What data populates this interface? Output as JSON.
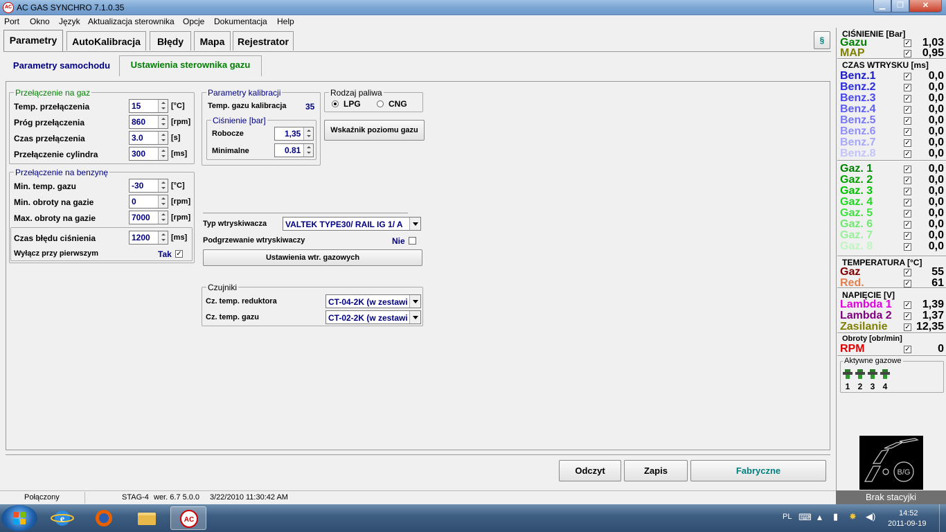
{
  "window": {
    "title": "AC GAS SYNCHRO  7.1.0.35",
    "icon_text": "AC",
    "min": "▁",
    "max": "❐",
    "close": "✕"
  },
  "menu": [
    "Port",
    "Okno",
    "Język",
    "Aktualizacja sterownika",
    "Opcje",
    "Dokumentacja",
    "Help"
  ],
  "tabs": [
    "Parametry",
    "AutoKalibracja",
    "Błędy",
    "Mapa",
    "Rejestrator"
  ],
  "subtabs": [
    "Parametry samochodu",
    "Ustawienia sterownika gazu"
  ],
  "gas_switch": {
    "title": "Przełączenie na gaz",
    "rows": [
      {
        "label": "Temp. przełączenia",
        "value": "15",
        "unit": "[°C]"
      },
      {
        "label": "Próg przełączenia",
        "value": "860",
        "unit": "[rpm]"
      },
      {
        "label": "Czas przełączenia",
        "value": "3.0",
        "unit": "[s]"
      },
      {
        "label": "Przełączenie cylindra",
        "value": "300",
        "unit": "[ms]"
      }
    ]
  },
  "petrol_switch": {
    "title": "Przełączenie na benzynę",
    "rows": [
      {
        "label": "Min. temp. gazu",
        "value": "-30",
        "unit": "[°C]"
      },
      {
        "label": "Min. obroty na gazie",
        "value": "0",
        "unit": "[rpm]"
      },
      {
        "label": "Max. obroty na gazie",
        "value": "7000",
        "unit": "[rpm]"
      }
    ]
  },
  "pressure_error": {
    "label": "Czas błędu ciśnienia",
    "value": "1200",
    "unit": "[ms]",
    "first_label": "Wyłącz przy pierwszym",
    "first_value": "Tak",
    "check": "✓"
  },
  "calibration": {
    "title": "Parametry kalibracji",
    "temp_label": "Temp. gazu kalibracja",
    "temp_value": "35",
    "pressure_title": "Ciśnienie [bar]",
    "working_label": "Robocze",
    "working_value": "1,35",
    "min_label": "Minimalne",
    "min_value": "0.81"
  },
  "fuel": {
    "title": "Rodzaj paliwa",
    "lpg": "LPG",
    "cng": "CNG",
    "selected": "LPG"
  },
  "gas_level_button": "Wskaźnik poziomu gazu",
  "injector": {
    "type_label": "Typ wtryskiwacza",
    "type_value": "VALTEK TYPE30/ RAIL IG 1/ A",
    "heat_label": "Podgrzewanie wtryskiwaczy",
    "heat_value": "Nie",
    "settings_button": "Ustawienia wtr. gazowych"
  },
  "sensors": {
    "title": "Czujniki",
    "reducer_label": "Cz. temp. reduktora",
    "reducer_value": "CT-04-2K (w zestawi",
    "gas_label": "Cz. temp. gazu",
    "gas_value": "CT-02-2K (w zestawi"
  },
  "buttons": {
    "read": "Odczyt",
    "write": "Zapis",
    "factory": "Fabryczne"
  },
  "right_panel": {
    "pressure_title": "CIŚNIENIE [Bar]",
    "pressure": [
      {
        "name": "Gazu",
        "value": "1,03",
        "color": "#008000"
      },
      {
        "name": "MAP",
        "value": "0,95",
        "color": "#808000"
      }
    ],
    "inj_title": "CZAS WTRYSKU  [ms]",
    "petrol": [
      {
        "name": "Benz.1",
        "value": "0,0",
        "color": "#1a1acc"
      },
      {
        "name": "Benz.2",
        "value": "0,0",
        "color": "#2d2de0"
      },
      {
        "name": "Benz.3",
        "value": "0,0",
        "color": "#4848ee"
      },
      {
        "name": "Benz.4",
        "value": "0,0",
        "color": "#5f5ff2"
      },
      {
        "name": "Benz.5",
        "value": "0,0",
        "color": "#7878f5"
      },
      {
        "name": "Benz.6",
        "value": "0,0",
        "color": "#9090f7"
      },
      {
        "name": "Benz.7",
        "value": "0,0",
        "color": "#a8a8f8"
      },
      {
        "name": "Benz.8",
        "value": "0,0",
        "color": "#c4c4fa"
      }
    ],
    "gas": [
      {
        "name": "Gaz. 1",
        "value": "0,0",
        "color": "#008000"
      },
      {
        "name": "Gaz. 2",
        "value": "0,0",
        "color": "#00a000"
      },
      {
        "name": "Gaz. 3",
        "value": "0,0",
        "color": "#00c000"
      },
      {
        "name": "Gaz. 4",
        "value": "0,0",
        "color": "#20d820"
      },
      {
        "name": "Gaz. 5",
        "value": "0,0",
        "color": "#40e040"
      },
      {
        "name": "Gaz. 6",
        "value": "0,0",
        "color": "#70e870"
      },
      {
        "name": "Gaz. 7",
        "value": "0,0",
        "color": "#98f098"
      },
      {
        "name": "Gaz. 8",
        "value": "0,0",
        "color": "#c0f4c0"
      }
    ],
    "temp_title": "TEMPERATURA  [°C]",
    "temp": [
      {
        "name": "Gaz",
        "value": "55",
        "color": "#800000"
      },
      {
        "name": "Red.",
        "value": "61",
        "color": "#e08050"
      }
    ],
    "volt_title": "NAPIĘCIE [V]",
    "volt": [
      {
        "name": "Lambda 1",
        "value": "1,39",
        "color": "#e000e0"
      },
      {
        "name": "Lambda 2",
        "value": "1,37",
        "color": "#800080"
      },
      {
        "name": "Zasilanie",
        "value": "12,35",
        "color": "#808000"
      }
    ],
    "rpm_title": "Obroty [obr/min]",
    "rpm": [
      {
        "name": "RPM",
        "value": "0",
        "color": "#e00000"
      }
    ],
    "active_title": "Aktywne gazowe",
    "active": [
      "1",
      "2",
      "3",
      "4"
    ],
    "check": "✓",
    "logo_text": "B/G"
  },
  "status": {
    "state": "Połączony",
    "device": "STAG-4",
    "version": "wer. 6.7  5.0.0",
    "date": "3/22/2010 11:30:42 AM",
    "station": "Brak stacyjki"
  },
  "taskbar": {
    "lang": "PL",
    "time": "14:52",
    "date": "2011-09-19",
    "app_icon_text": "AC"
  }
}
